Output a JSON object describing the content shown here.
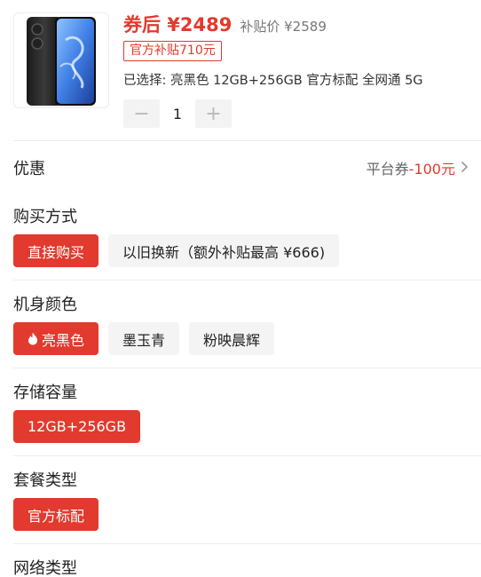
{
  "product": {
    "coupon_price": "券后 ¥2489",
    "original_price": "补贴价 ¥2589",
    "subsidy_tag": "官方补贴710元",
    "selected_spec": "已选择: 亮黑色 12GB+256GB 官方标配 全网通 5G",
    "quantity": "1",
    "minus": "−",
    "plus": "+"
  },
  "discount": {
    "label": "优惠",
    "prefix": "平台券",
    "amount": "-100元",
    "chevron": "›"
  },
  "sections": {
    "purchase": {
      "title": "购买方式",
      "options": [
        "直接购买",
        "以旧换新（额外补贴最高 ¥666)"
      ]
    },
    "color": {
      "title": "机身颜色",
      "options": [
        "亮黑色",
        "墨玉青",
        "粉映晨辉"
      ]
    },
    "storage": {
      "title": "存储容量",
      "options": [
        "12GB+256GB"
      ]
    },
    "bundle": {
      "title": "套餐类型",
      "options": [
        "官方标配"
      ]
    },
    "network": {
      "title": "网络类型"
    }
  },
  "colors": {
    "accent": "#e23a2e",
    "option_bg": "#f4f4f4",
    "divider": "#ededed"
  },
  "icons": {
    "flame": "flame-icon",
    "chevron": "chevron-right-icon"
  }
}
